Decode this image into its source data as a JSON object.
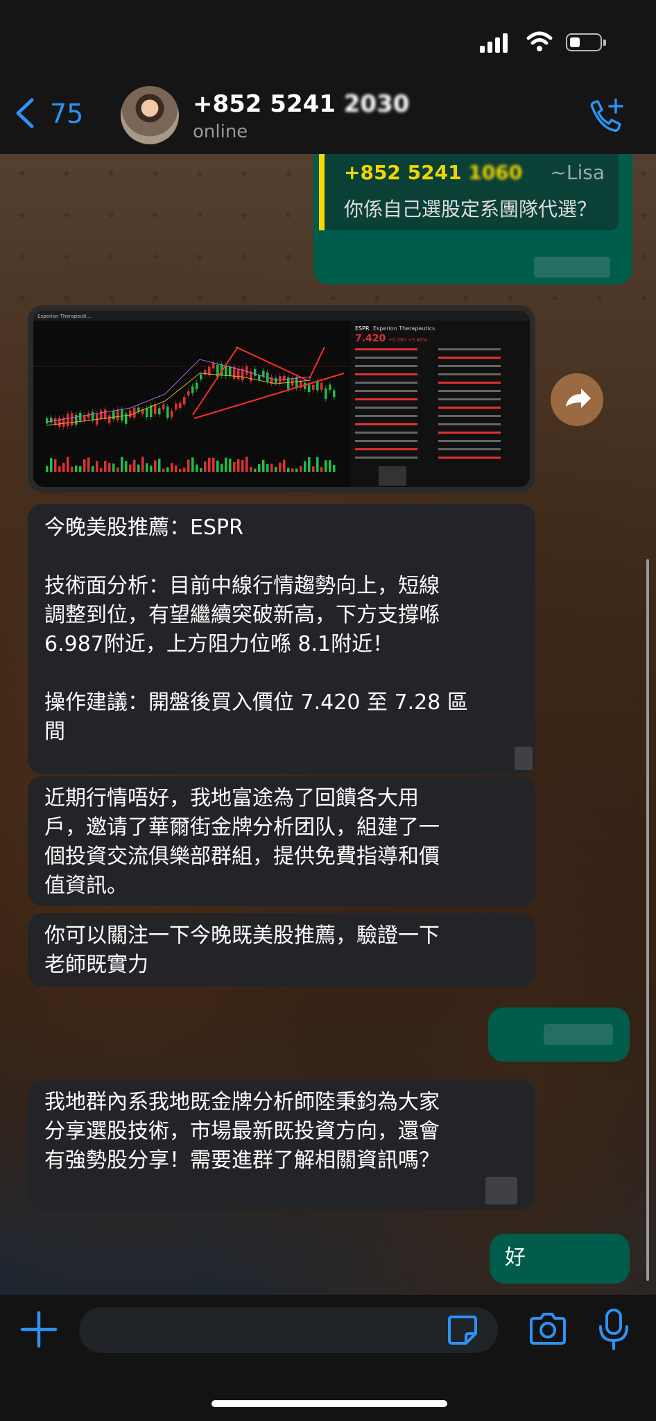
{
  "header": {
    "back_count": "75",
    "contact_name": "+852 5241 ",
    "contact_redacted": "2030",
    "presence": "online"
  },
  "quoted_message": {
    "sender_number": "+852 5241 ",
    "sender_redacted": "1060",
    "sender_alias": "~Lisa",
    "text": "你係自己選股定系團隊代選？"
  },
  "chart_thumbnail": {
    "ticker": "ESPR",
    "company": "Esperion Therapeutics",
    "price": "7.420",
    "change": "+0.380 +5.40%",
    "window_title": "Esperion Therapeuti...",
    "chart_colors": {
      "background": "#0b0b0b",
      "up": "#1fbf4a",
      "down": "#e03131",
      "trend": "#ff2d2d"
    }
  },
  "messages": [
    {
      "id": "espr",
      "direction": "in",
      "lines": [
        "今晚美股推薦：ESPR",
        "",
        "技術面分析：目前中線行情趨勢向上，短線",
        "調整到位，有望繼續突破新高，下方支撐喺",
        "6.987附近，上方阻力位喺 8.1附近！",
        "",
        "操作建議：開盤後買入價位 7.420 至 7.28 區",
        "間"
      ]
    },
    {
      "id": "club",
      "direction": "in",
      "lines": [
        "近期行情唔好，我地富途為了回饋各大用",
        "戶，邀请了華爾街金牌分析团队，組建了一",
        "個投資交流俱樂部群組，提供免費指導和價",
        "值資訊。"
      ]
    },
    {
      "id": "verify",
      "direction": "in",
      "lines": [
        "你可以關注一下今晚既美股推薦，驗證一下",
        "老師既實力"
      ]
    },
    {
      "id": "group",
      "direction": "in",
      "lines": [
        "我地群內系我地既金牌分析師陸秉鈞為大家",
        "分享選股技術，市場最新既投資方向，還會",
        "有強勢股分享！需要進群了解相關資訊嗎？"
      ]
    },
    {
      "id": "reply",
      "direction": "out",
      "lines": [
        "好"
      ]
    }
  ],
  "composer": {
    "placeholder": ""
  },
  "icons": {
    "back": "chevron-left-icon",
    "call": "phone-plus-icon",
    "forward": "forward-arrow-icon",
    "attach": "plus-icon",
    "sticker": "sticker-icon",
    "camera": "camera-icon",
    "mic": "microphone-icon"
  },
  "colors": {
    "accent": "#2c93f5",
    "outgoing_bubble": "#005c4b",
    "incoming_bubble": "#232428",
    "quote_bar": "#f5d900"
  }
}
